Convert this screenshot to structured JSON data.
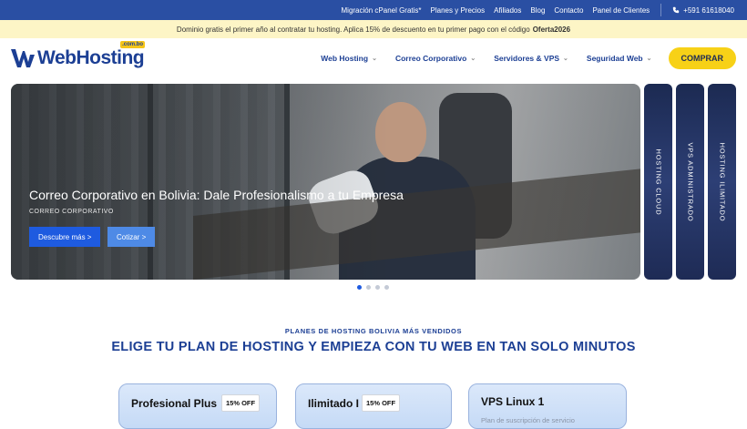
{
  "topbar": {
    "links": [
      "Migración cPanel Gratis*",
      "Planes y Precios",
      "Afiliados",
      "Blog",
      "Contacto",
      "Panel de Clientes"
    ],
    "phone": "+591 61618040"
  },
  "promo": {
    "text": "Dominio gratis el primer año al contratar tu hosting. Aplica 15% de descuento en tu primer pago con el código",
    "code": "Oferta2026"
  },
  "logo": {
    "text": "WebHosting",
    "badge": ".com.bo"
  },
  "menu": {
    "items": [
      "Web Hosting",
      "Correo Corporativo",
      "Servidores & VPS",
      "Seguridad Web"
    ],
    "buy_label": "COMPRAR"
  },
  "hero": {
    "title": "Correo Corporativo en Bolivia: Dale Profesionalismo a tu Empresa",
    "subtitle": "CORREO CORPORATIVO",
    "primary_button": "Descubre más >",
    "secondary_button": "Cotizar >"
  },
  "side_tabs": [
    "HOSTING CLOUD",
    "VPS ADMINISTRADO",
    "HOSTING ILIMITADO"
  ],
  "carousel": {
    "slides": 4,
    "active": 1
  },
  "section": {
    "kicker": "PLANES DE HOSTING BOLIVIA MÁS VENDIDOS",
    "headline": "ELIGE TU PLAN DE HOSTING Y EMPIEZA CON TU WEB EN TAN SOLO MINUTOS"
  },
  "plans": [
    {
      "name": "Profesional Plus",
      "tag": "15% OFF"
    },
    {
      "name": "Ilimitado I",
      "tag": "15% OFF"
    },
    {
      "name": "VPS Linux 1",
      "desc": "Plan de suscripción de servicio"
    }
  ],
  "colors": {
    "brand": "#1c3f94",
    "accent": "#f7d117",
    "button": "#1e5be0"
  }
}
